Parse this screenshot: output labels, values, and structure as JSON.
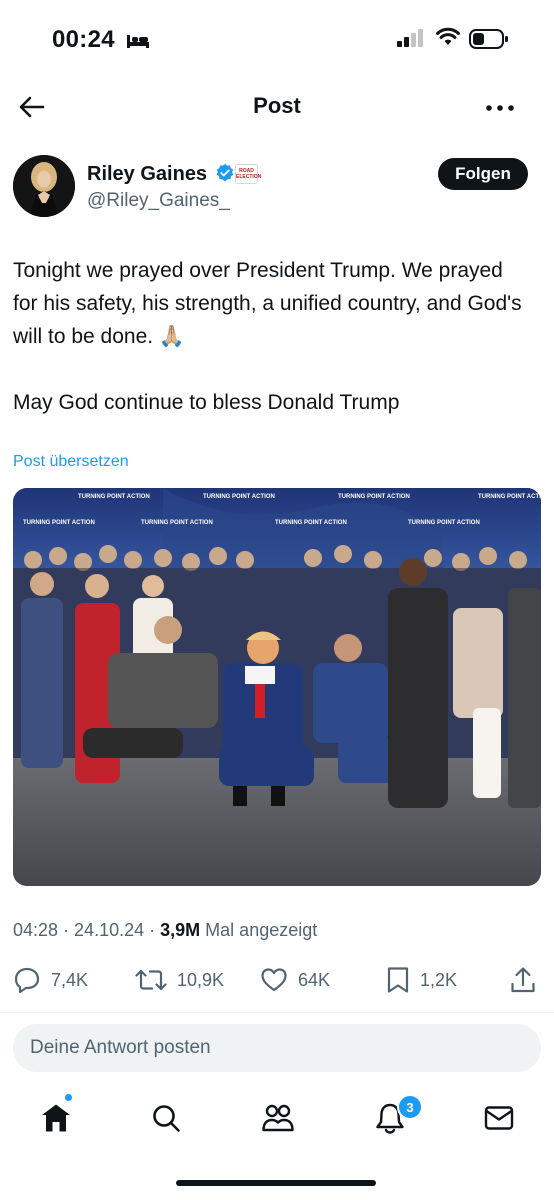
{
  "status_bar": {
    "time": "00:24"
  },
  "header": {
    "title": "Post"
  },
  "author": {
    "name": "Riley Gaines",
    "handle": "@Riley_Gaines_",
    "affiliation_badge": "ROAD ELECTION",
    "follow_label": "Folgen"
  },
  "tweet": {
    "text": "Tonight we prayed over President Trump. We prayed for his safety, his strength, a unified country, and God's will to be done. 🙏🏼\n\nMay God continue to bless Donald Trump",
    "translate_label": "Post übersetzen",
    "image_banner_text": "TURNING POINT ACTION"
  },
  "meta": {
    "time": "04:28",
    "date": "24.10.24",
    "views": "3,9M",
    "views_suffix": "Mal angezeigt"
  },
  "actions": {
    "replies": "7,4K",
    "reposts": "10,9K",
    "likes": "64K",
    "bookmarks": "1,2K"
  },
  "reply": {
    "placeholder": "Deine Antwort posten"
  },
  "bottom_nav": {
    "notifications_badge": "3"
  },
  "colors": {
    "accent": "#1d9bf0",
    "text": "#0f1419",
    "secondary": "#536471"
  },
  "icons": [
    "back-arrow-icon",
    "more-icon",
    "verified-icon",
    "reply-icon",
    "repost-icon",
    "like-icon",
    "bookmark-icon",
    "share-icon",
    "home-icon",
    "search-icon",
    "communities-icon",
    "notifications-icon",
    "messages-icon"
  ]
}
